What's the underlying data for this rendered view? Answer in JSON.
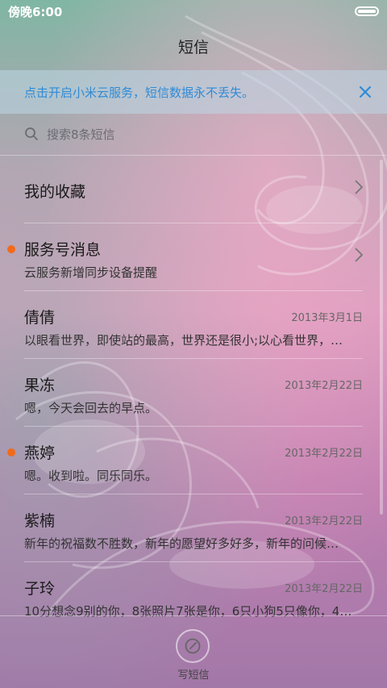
{
  "statusbar": {
    "time": "傍晚6:00"
  },
  "header": {
    "title": "短信"
  },
  "banner": {
    "text": "点击开启小米云服务，短信数据永不丢失。"
  },
  "search": {
    "placeholder": "搜索8条短信"
  },
  "threads": [
    {
      "name": "我的收藏",
      "preview": "",
      "date": "",
      "unread": false,
      "has_chevron": true
    },
    {
      "name": "服务号消息",
      "preview": "云服务新增同步设备提醒",
      "date": "",
      "unread": true,
      "has_chevron": true
    },
    {
      "name": "倩倩",
      "preview": "以眼看世界，即使站的最高，世界还是很小;以心看世界，…",
      "date": "2013年3月1日",
      "unread": false,
      "has_chevron": false
    },
    {
      "name": "果冻",
      "preview": "嗯，今天会回去的早点。",
      "date": "2013年2月22日",
      "unread": false,
      "has_chevron": false
    },
    {
      "name": "燕婷",
      "preview": "嗯。收到啦。同乐同乐。",
      "date": "2013年2月22日",
      "unread": true,
      "has_chevron": false
    },
    {
      "name": "紫楠",
      "preview": "新年的祝福数不胜数，新年的愿望好多好多，新年的问候…",
      "date": "2013年2月22日",
      "unread": false,
      "has_chevron": false
    },
    {
      "name": "子玲",
      "preview": "10分想念9别的你，8张照片7张是你，6只小狗5只像你，4…",
      "date": "2013年2月22日",
      "unread": false,
      "has_chevron": false
    }
  ],
  "compose": {
    "label": "写短信"
  },
  "colors": {
    "accent": "#2f8bd7",
    "unread_dot": "#f26a1b"
  }
}
